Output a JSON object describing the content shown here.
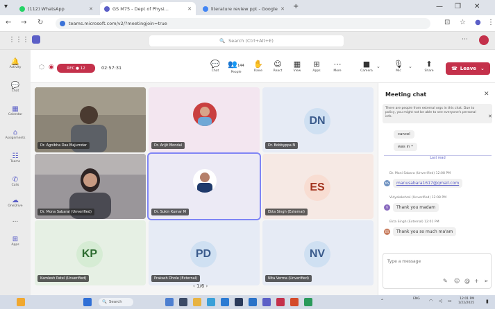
{
  "browser": {
    "tabs": [
      {
        "label": "(112) WhatsApp",
        "color": "#25d366"
      },
      {
        "label": "GS M75 - Dept of Physi...",
        "color": "#5b5fc7"
      },
      {
        "label": "literature review ppt - Google",
        "color": "#4285f4"
      }
    ],
    "new_tab": "+",
    "url": "teams.microsoft.com/v2/?meetingjoin=true"
  },
  "teams": {
    "search_placeholder": "Search (Ctrl+Alt+E)",
    "rail": [
      {
        "label": "Activity",
        "icon": "bell-icon"
      },
      {
        "label": "Chat",
        "icon": "chat-icon"
      },
      {
        "label": "Calendar",
        "icon": "calendar-icon"
      },
      {
        "label": "Assignments",
        "icon": "backpack-icon"
      },
      {
        "label": "Teams",
        "icon": "teams-icon"
      },
      {
        "label": "Calls",
        "icon": "phone-icon"
      },
      {
        "label": "OneDrive",
        "icon": "cloud-icon"
      },
      {
        "label": "...",
        "icon": "more-icon"
      },
      {
        "label": "Apps",
        "icon": "apps-icon"
      }
    ]
  },
  "meeting": {
    "recording_label": "REC ● 12",
    "timer": "02:57:31",
    "toolbar": [
      {
        "label": "Chat",
        "icon": "chat-icon",
        "glyph": "💬"
      },
      {
        "label": "People",
        "icon": "people-icon",
        "glyph": "👥",
        "badge": "144"
      },
      {
        "label": "Raise",
        "icon": "hand-icon",
        "glyph": "✋"
      },
      {
        "label": "React",
        "icon": "emoji-icon",
        "glyph": "☺"
      },
      {
        "label": "View",
        "icon": "grid-icon",
        "glyph": "▦"
      },
      {
        "label": "Apps",
        "icon": "plus-box-icon",
        "glyph": "⊞"
      },
      {
        "label": "More",
        "icon": "ellipsis-icon",
        "glyph": "⋯"
      },
      {
        "label": "Camera",
        "icon": "camera-icon",
        "glyph": "■"
      },
      {
        "label": "Mic",
        "icon": "mic-icon",
        "glyph": "🎙"
      },
      {
        "label": "Share",
        "icon": "share-icon",
        "glyph": "⬆"
      }
    ],
    "leave_label": "Leave",
    "participants": [
      {
        "name": "Dr. Agnibha Das Majumdar",
        "type": "video",
        "bg": "#6a6257"
      },
      {
        "name": "Dr. Arijit Mondal",
        "type": "photo",
        "bg": "#f3e6f0"
      },
      {
        "name": "Dr. Bobbyppa N",
        "type": "initials",
        "initials": "DN",
        "color": "#3a5b8c",
        "circle": "#cfe0f2",
        "bg": "#e6ebf5"
      },
      {
        "name": "Dr. Mona Sabarai (Unverified)",
        "type": "video",
        "bg": "#7d7b7e"
      },
      {
        "name": "Dr. Sukin Kumar M",
        "type": "photo",
        "bg": "#eceaf5",
        "selected": true
      },
      {
        "name": "Ekta Singh (External)",
        "type": "initials",
        "initials": "ES",
        "color": "#a3341f",
        "circle": "#f8ddd2",
        "bg": "#f6e9e4"
      },
      {
        "name": "Kamlesh Patel (Unverified)",
        "type": "initials",
        "initials": "KP",
        "color": "#2c6b2f",
        "circle": "#d6ecd4",
        "bg": "#e6f0e4"
      },
      {
        "name": "Prakash Dhole (External)",
        "type": "initials",
        "initials": "PD",
        "color": "#3a5b8c",
        "circle": "#cfe0f2",
        "bg": "#e6ebf5"
      },
      {
        "name": "Nita Verma (Unverified)",
        "type": "initials",
        "initials": "NV",
        "color": "#3a5b8c",
        "circle": "#cfe0f2",
        "bg": "#e6ebf5"
      }
    ],
    "pagination": "1/6"
  },
  "chat": {
    "title": "Meeting chat",
    "banner": "There are people from external orgs in this chat. Due to policy, you might not be able to see everyone's personal info.",
    "earlier_messages": [
      "cancel",
      "was in *"
    ],
    "last_read": "Last read",
    "messages": [
      {
        "meta": "Dr. Mani Sabara (Unverified) 12:08 PM",
        "text": "manusabara1617@gmail.com",
        "is_link": true,
        "initial": "MS",
        "dot_color": "#6b8fbf"
      },
      {
        "meta": "Vidyalakshmi (Unverified) 12:08 PM",
        "text": "Thank you madam",
        "is_link": false,
        "initial": "V",
        "dot_color": "#8a6bbf"
      },
      {
        "meta": "Ekta Singh (External) 12:01 PM",
        "text": "Thank you so much ma'am",
        "is_link": false,
        "initial": "ES",
        "dot_color": "#c77a5b"
      }
    ],
    "compose_placeholder": "Type a message"
  },
  "taskbar": {
    "search_label": "Search",
    "clock_time": "12:01 PM",
    "clock_date": "1/22/2025",
    "lang": "ENG"
  }
}
